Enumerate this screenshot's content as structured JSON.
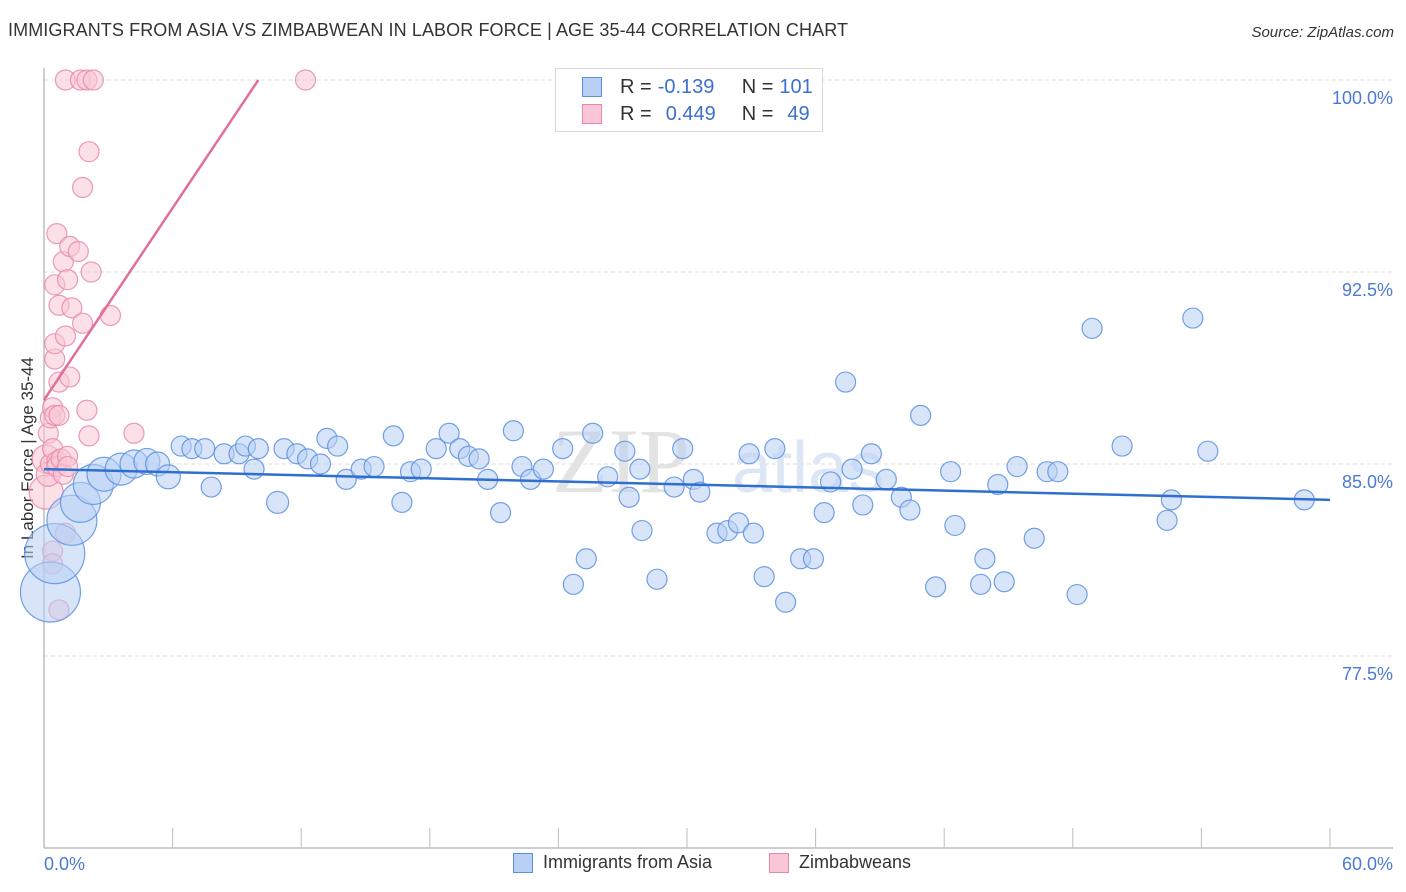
{
  "header": {
    "title": "IMMIGRANTS FROM ASIA VS ZIMBABWEAN IN LABOR FORCE | AGE 35-44 CORRELATION CHART",
    "source": "Source: ZipAtlas.com"
  },
  "legend": {
    "rows": [
      {
        "r_label": "R =",
        "r_value": "-0.139",
        "n_label": "N =",
        "n_value": "101"
      },
      {
        "r_label": "R =",
        "r_value": "0.449",
        "n_label": "N =",
        "n_value": "49"
      }
    ]
  },
  "colors": {
    "asia_fill": "#b8d0f4",
    "asia_stroke": "#5b8fe0",
    "asia_line": "#2f6fd0",
    "zim_fill": "#f8c6d6",
    "zim_stroke": "#e989a8",
    "zim_line": "#e07098",
    "tick_text": "#4a7ad4"
  },
  "watermark": {
    "part1": "ZIP",
    "part2": "atlas"
  },
  "chart_data": {
    "type": "scatter",
    "title": "IMMIGRANTS FROM ASIA VS ZIMBABWEAN IN LABOR FORCE | AGE 35-44 CORRELATION CHART",
    "xlabel": "",
    "ylabel": "In Labor Force | Age 35-44",
    "xlim": [
      0,
      60
    ],
    "ylim": [
      70.2,
      102.2
    ],
    "x_tick_labels": [
      "0.0%",
      "60.0%"
    ],
    "y_ticks": [
      77.5,
      85.0,
      92.5,
      100.0
    ],
    "y_tick_labels": [
      "77.5%",
      "85.0%",
      "92.5%",
      "100.0%"
    ],
    "grid": "horizontal-dashed",
    "legend_placement": "top-center",
    "series": [
      {
        "name": "Immigrants from Asia",
        "r": -0.139,
        "n": 101,
        "trend": {
          "x": [
            0.0,
            60.0
          ],
          "y": [
            84.8,
            83.6
          ]
        },
        "points": [
          {
            "x": 0.3,
            "y": 80.0,
            "s": 3
          },
          {
            "x": 0.5,
            "y": 81.5,
            "s": 3
          },
          {
            "x": 1.3,
            "y": 82.8,
            "s": 2.5
          },
          {
            "x": 1.7,
            "y": 83.5,
            "s": 2
          },
          {
            "x": 2.3,
            "y": 84.2,
            "s": 2
          },
          {
            "x": 2.8,
            "y": 84.6,
            "s": 1.7
          },
          {
            "x": 3.6,
            "y": 84.8,
            "s": 1.6
          },
          {
            "x": 4.2,
            "y": 85.0,
            "s": 1.4
          },
          {
            "x": 4.8,
            "y": 85.1,
            "s": 1.3
          },
          {
            "x": 5.3,
            "y": 85.0,
            "s": 1.2
          },
          {
            "x": 5.8,
            "y": 84.5,
            "s": 1.2
          },
          {
            "x": 6.4,
            "y": 85.7,
            "s": 1
          },
          {
            "x": 6.9,
            "y": 85.6,
            "s": 1
          },
          {
            "x": 7.5,
            "y": 85.6,
            "s": 1
          },
          {
            "x": 7.8,
            "y": 84.1,
            "s": 1
          },
          {
            "x": 8.4,
            "y": 85.4,
            "s": 1
          },
          {
            "x": 9.1,
            "y": 85.4,
            "s": 1
          },
          {
            "x": 9.4,
            "y": 85.7,
            "s": 1
          },
          {
            "x": 9.8,
            "y": 84.8,
            "s": 1
          },
          {
            "x": 10.0,
            "y": 85.6,
            "s": 1
          },
          {
            "x": 10.9,
            "y": 83.5,
            "s": 1.1
          },
          {
            "x": 11.2,
            "y": 85.6,
            "s": 1
          },
          {
            "x": 11.8,
            "y": 85.4,
            "s": 1
          },
          {
            "x": 12.3,
            "y": 85.2,
            "s": 1
          },
          {
            "x": 12.9,
            "y": 85.0,
            "s": 1
          },
          {
            "x": 13.2,
            "y": 86.0,
            "s": 1
          },
          {
            "x": 13.7,
            "y": 85.7,
            "s": 1
          },
          {
            "x": 14.1,
            "y": 84.4,
            "s": 1
          },
          {
            "x": 14.8,
            "y": 84.8,
            "s": 1
          },
          {
            "x": 15.4,
            "y": 84.9,
            "s": 1
          },
          {
            "x": 16.3,
            "y": 86.1,
            "s": 1
          },
          {
            "x": 16.7,
            "y": 83.5,
            "s": 1
          },
          {
            "x": 17.1,
            "y": 84.7,
            "s": 1
          },
          {
            "x": 17.6,
            "y": 84.8,
            "s": 1
          },
          {
            "x": 18.3,
            "y": 85.6,
            "s": 1
          },
          {
            "x": 18.9,
            "y": 86.2,
            "s": 1
          },
          {
            "x": 19.4,
            "y": 85.6,
            "s": 1
          },
          {
            "x": 19.8,
            "y": 85.3,
            "s": 1
          },
          {
            "x": 20.3,
            "y": 85.2,
            "s": 1
          },
          {
            "x": 20.7,
            "y": 84.4,
            "s": 1
          },
          {
            "x": 21.3,
            "y": 83.1,
            "s": 1
          },
          {
            "x": 21.9,
            "y": 86.3,
            "s": 1
          },
          {
            "x": 22.3,
            "y": 84.9,
            "s": 1
          },
          {
            "x": 22.7,
            "y": 84.4,
            "s": 1
          },
          {
            "x": 23.3,
            "y": 84.8,
            "s": 1
          },
          {
            "x": 24.2,
            "y": 85.6,
            "s": 1
          },
          {
            "x": 24.7,
            "y": 80.3,
            "s": 1
          },
          {
            "x": 25.3,
            "y": 81.3,
            "s": 1
          },
          {
            "x": 25.6,
            "y": 86.2,
            "s": 1
          },
          {
            "x": 26.3,
            "y": 84.5,
            "s": 1
          },
          {
            "x": 27.1,
            "y": 85.5,
            "s": 1
          },
          {
            "x": 27.3,
            "y": 83.7,
            "s": 1
          },
          {
            "x": 27.8,
            "y": 84.8,
            "s": 1
          },
          {
            "x": 27.9,
            "y": 82.4,
            "s": 1
          },
          {
            "x": 28.6,
            "y": 80.5,
            "s": 1
          },
          {
            "x": 29.4,
            "y": 84.1,
            "s": 1
          },
          {
            "x": 29.8,
            "y": 85.6,
            "s": 1
          },
          {
            "x": 30.3,
            "y": 84.4,
            "s": 1
          },
          {
            "x": 30.6,
            "y": 83.9,
            "s": 1
          },
          {
            "x": 31.4,
            "y": 82.3,
            "s": 1
          },
          {
            "x": 31.9,
            "y": 82.4,
            "s": 1
          },
          {
            "x": 32.4,
            "y": 82.7,
            "s": 1
          },
          {
            "x": 32.9,
            "y": 85.4,
            "s": 1
          },
          {
            "x": 33.1,
            "y": 82.3,
            "s": 1
          },
          {
            "x": 33.6,
            "y": 80.6,
            "s": 1
          },
          {
            "x": 34.1,
            "y": 85.6,
            "s": 1
          },
          {
            "x": 34.6,
            "y": 79.6,
            "s": 1
          },
          {
            "x": 35.3,
            "y": 81.3,
            "s": 1
          },
          {
            "x": 35.9,
            "y": 81.3,
            "s": 1
          },
          {
            "x": 36.4,
            "y": 83.1,
            "s": 1
          },
          {
            "x": 36.7,
            "y": 84.3,
            "s": 1
          },
          {
            "x": 37.4,
            "y": 88.2,
            "s": 1
          },
          {
            "x": 37.7,
            "y": 84.8,
            "s": 1
          },
          {
            "x": 38.2,
            "y": 83.4,
            "s": 1
          },
          {
            "x": 38.6,
            "y": 85.4,
            "s": 1
          },
          {
            "x": 39.3,
            "y": 84.4,
            "s": 1
          },
          {
            "x": 40.0,
            "y": 83.7,
            "s": 1
          },
          {
            "x": 40.4,
            "y": 83.2,
            "s": 1
          },
          {
            "x": 40.9,
            "y": 86.9,
            "s": 1
          },
          {
            "x": 41.6,
            "y": 80.2,
            "s": 1
          },
          {
            "x": 42.3,
            "y": 84.7,
            "s": 1
          },
          {
            "x": 42.5,
            "y": 82.6,
            "s": 1
          },
          {
            "x": 43.7,
            "y": 80.3,
            "s": 1
          },
          {
            "x": 43.9,
            "y": 81.3,
            "s": 1
          },
          {
            "x": 44.5,
            "y": 84.2,
            "s": 1
          },
          {
            "x": 44.8,
            "y": 80.4,
            "s": 1
          },
          {
            "x": 45.4,
            "y": 84.9,
            "s": 1
          },
          {
            "x": 46.2,
            "y": 82.1,
            "s": 1
          },
          {
            "x": 46.8,
            "y": 84.7,
            "s": 1
          },
          {
            "x": 47.3,
            "y": 84.7,
            "s": 1
          },
          {
            "x": 48.2,
            "y": 79.9,
            "s": 1
          },
          {
            "x": 48.9,
            "y": 90.3,
            "s": 1
          },
          {
            "x": 50.3,
            "y": 85.7,
            "s": 1
          },
          {
            "x": 52.4,
            "y": 82.8,
            "s": 1
          },
          {
            "x": 52.6,
            "y": 83.6,
            "s": 1
          },
          {
            "x": 53.6,
            "y": 90.7,
            "s": 1
          },
          {
            "x": 54.3,
            "y": 85.5,
            "s": 1
          },
          {
            "x": 58.8,
            "y": 83.6,
            "s": 1
          }
        ]
      },
      {
        "name": "Zimbabweans",
        "r": 0.449,
        "n": 49,
        "trend": {
          "x": [
            0.0,
            10.0
          ],
          "y": [
            87.5,
            100.0
          ]
        },
        "points": [
          {
            "x": 0.1,
            "y": 83.9,
            "s": 1.7
          },
          {
            "x": 0.1,
            "y": 85.2,
            "s": 1.4
          },
          {
            "x": 0.2,
            "y": 84.6,
            "s": 1.2
          },
          {
            "x": 0.2,
            "y": 86.2,
            "s": 1
          },
          {
            "x": 0.3,
            "y": 86.8,
            "s": 1
          },
          {
            "x": 0.3,
            "y": 85.0,
            "s": 1
          },
          {
            "x": 0.4,
            "y": 87.2,
            "s": 1
          },
          {
            "x": 0.4,
            "y": 85.6,
            "s": 1
          },
          {
            "x": 0.4,
            "y": 81.6,
            "s": 1
          },
          {
            "x": 0.4,
            "y": 81.1,
            "s": 1
          },
          {
            "x": 0.5,
            "y": 89.1,
            "s": 1
          },
          {
            "x": 0.5,
            "y": 92.0,
            "s": 1
          },
          {
            "x": 0.5,
            "y": 89.7,
            "s": 1
          },
          {
            "x": 0.5,
            "y": 86.9,
            "s": 1
          },
          {
            "x": 0.6,
            "y": 94.0,
            "s": 1
          },
          {
            "x": 0.6,
            "y": 85.1,
            "s": 1
          },
          {
            "x": 0.6,
            "y": 84.9,
            "s": 1
          },
          {
            "x": 0.7,
            "y": 88.2,
            "s": 1
          },
          {
            "x": 0.7,
            "y": 86.9,
            "s": 1
          },
          {
            "x": 0.7,
            "y": 91.2,
            "s": 1
          },
          {
            "x": 0.7,
            "y": 79.3,
            "s": 1
          },
          {
            "x": 0.8,
            "y": 85.2,
            "s": 1
          },
          {
            "x": 0.9,
            "y": 92.9,
            "s": 1
          },
          {
            "x": 0.9,
            "y": 84.6,
            "s": 1
          },
          {
            "x": 1.0,
            "y": 82.3,
            "s": 1
          },
          {
            "x": 1.0,
            "y": 90.0,
            "s": 1
          },
          {
            "x": 1.0,
            "y": 100.0,
            "s": 1
          },
          {
            "x": 1.1,
            "y": 92.2,
            "s": 1
          },
          {
            "x": 1.1,
            "y": 85.3,
            "s": 1
          },
          {
            "x": 1.1,
            "y": 84.9,
            "s": 1
          },
          {
            "x": 1.2,
            "y": 93.5,
            "s": 1
          },
          {
            "x": 1.2,
            "y": 88.4,
            "s": 1
          },
          {
            "x": 1.3,
            "y": 91.1,
            "s": 1
          },
          {
            "x": 1.6,
            "y": 93.3,
            "s": 1
          },
          {
            "x": 1.7,
            "y": 100.0,
            "s": 1
          },
          {
            "x": 1.8,
            "y": 90.5,
            "s": 1
          },
          {
            "x": 1.8,
            "y": 95.8,
            "s": 1
          },
          {
            "x": 2.0,
            "y": 100.0,
            "s": 1
          },
          {
            "x": 2.0,
            "y": 87.1,
            "s": 1
          },
          {
            "x": 2.1,
            "y": 97.2,
            "s": 1
          },
          {
            "x": 2.1,
            "y": 86.1,
            "s": 1
          },
          {
            "x": 2.2,
            "y": 92.5,
            "s": 1
          },
          {
            "x": 2.3,
            "y": 100.0,
            "s": 1
          },
          {
            "x": 3.1,
            "y": 90.8,
            "s": 1
          },
          {
            "x": 4.2,
            "y": 86.2,
            "s": 1
          },
          {
            "x": 12.2,
            "y": 100.0,
            "s": 1
          }
        ]
      }
    ]
  },
  "bottom_legend": {
    "items": [
      {
        "label": "Immigrants from Asia"
      },
      {
        "label": "Zimbabweans"
      }
    ]
  }
}
